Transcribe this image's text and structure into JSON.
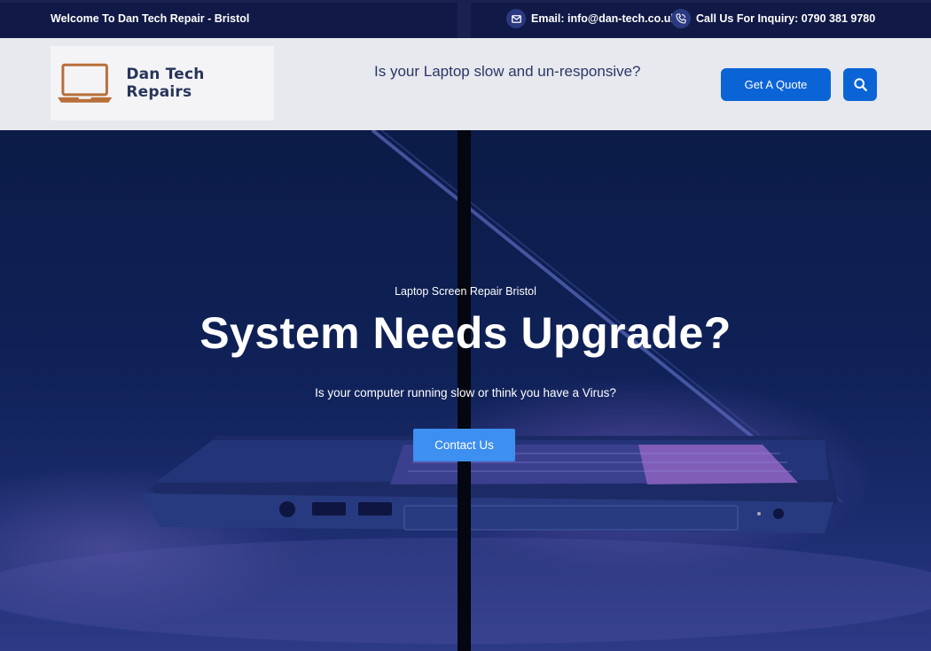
{
  "topbar": {
    "welcome": "Welcome To Dan Tech  Repair - Bristol",
    "email_label": "Email: info@dan-tech.co.uk",
    "phone_label": "Call Us For Inquiry:  0790 381 9780"
  },
  "header": {
    "brand_name": "Dan Tech Repairs",
    "tagline": "Is your Laptop slow and un-responsive?",
    "quote_button": "Get A Quote"
  },
  "hero": {
    "subtitle": "Laptop Screen Repair Bristol",
    "title": "System Needs Upgrade?",
    "description": "Is your computer running slow or think you have a Virus?",
    "cta_button": "Contact Us"
  },
  "icons": [
    "envelope-icon",
    "phone-icon",
    "laptop-logo-icon",
    "search-icon"
  ],
  "colors": {
    "topbar_bg": "#111a46",
    "header_bg": "#e8e9ee",
    "accent": "#0b64d6",
    "cta": "#3d8ff0",
    "hero_bg": "#0f2157"
  }
}
